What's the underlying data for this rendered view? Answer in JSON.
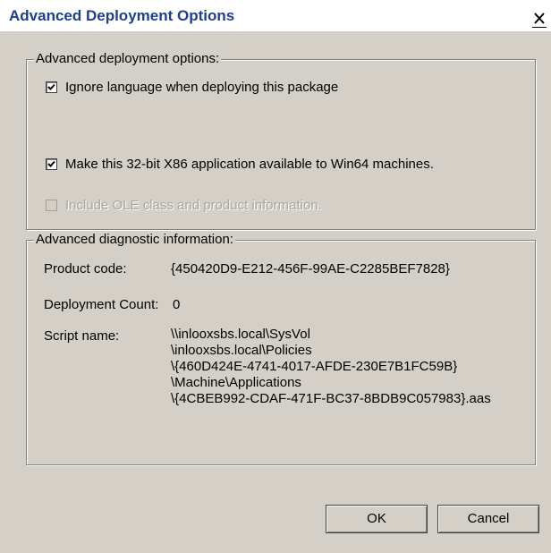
{
  "window": {
    "title": "Advanced Deployment Options",
    "close_icon": "close-icon"
  },
  "deployment_group": {
    "legend": "Advanced deployment options:",
    "options": [
      {
        "label": "Ignore language when deploying this package",
        "checked": true,
        "enabled": true
      },
      {
        "label": "Make this 32-bit X86 application available to Win64 machines.",
        "checked": true,
        "enabled": true
      },
      {
        "label": "Include OLE class and product information.",
        "checked": false,
        "enabled": false
      }
    ]
  },
  "diagnostic_group": {
    "legend": "Advanced diagnostic information:",
    "product_code_label": "Product code:",
    "product_code_value": "{450420D9-E212-456F-99AE-C2285BEF7828}",
    "deployment_count_label": "Deployment Count:",
    "deployment_count_value": "0",
    "script_name_label": "Script name:",
    "script_name_lines": [
      "\\\\inlooxsbs.local\\SysVol",
      "\\inlooxsbs.local\\Policies",
      "\\{460D424E-4741-4017-AFDE-230E7B1FC59B}",
      "\\Machine\\Applications",
      "\\{4CBEB992-CDAF-471F-BC37-8BDB9C057983}.aas"
    ]
  },
  "buttons": {
    "ok": "OK",
    "cancel": "Cancel"
  }
}
